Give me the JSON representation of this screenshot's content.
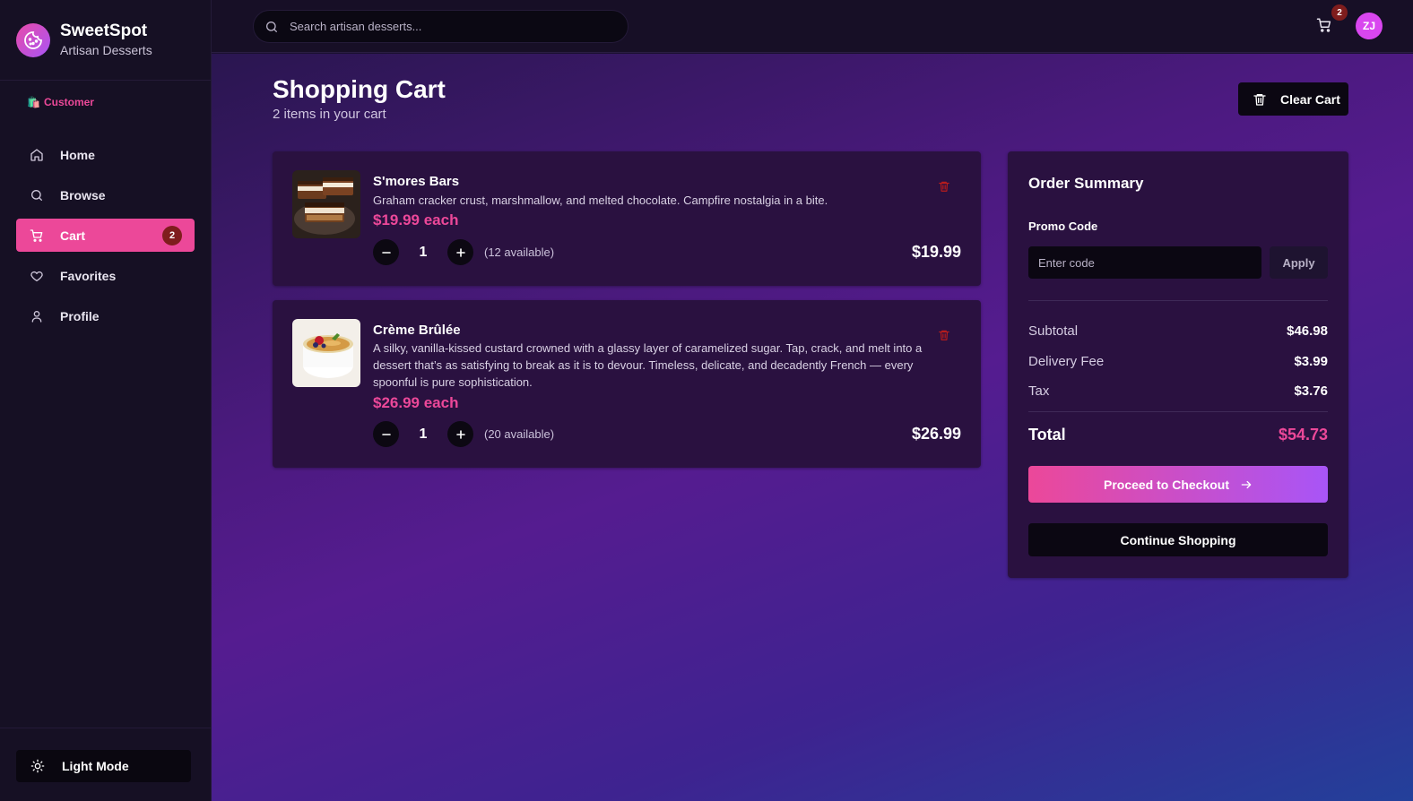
{
  "brand": {
    "name": "SweetSpot",
    "tagline": "Artisan Desserts"
  },
  "role": {
    "emoji": "🛍️",
    "label": "Customer"
  },
  "nav": {
    "items": [
      {
        "label": "Home",
        "icon": "home-icon"
      },
      {
        "label": "Browse",
        "icon": "search-icon"
      },
      {
        "label": "Cart",
        "icon": "cart-icon",
        "badge": "2",
        "active": true
      },
      {
        "label": "Favorites",
        "icon": "heart-icon"
      },
      {
        "label": "Profile",
        "icon": "user-icon"
      }
    ]
  },
  "theme_toggle": {
    "label": "Light Mode"
  },
  "topbar": {
    "search_placeholder": "Search artisan desserts...",
    "cart_badge": "2",
    "avatar_initials": "ZJ"
  },
  "page": {
    "title": "Shopping Cart",
    "subtitle": "2 items in your cart",
    "clear_label": "Clear Cart"
  },
  "cart_items": [
    {
      "name": "S'mores Bars",
      "description": "Graham cracker crust, marshmallow, and melted chocolate. Campfire nostalgia in a bite.",
      "price_each": "$19.99 each",
      "quantity": "1",
      "available": "(12 available)",
      "line_total": "$19.99"
    },
    {
      "name": "Crème Brûlée",
      "description": "A silky, vanilla-kissed custard crowned with a glassy layer of caramelized sugar. Tap, crack, and melt into a dessert that’s as satisfying to break as it is to devour. Timeless, delicate, and decadently French — every spoonful is pure sophistication.",
      "price_each": "$26.99 each",
      "quantity": "1",
      "available": "(20 available)",
      "line_total": "$26.99"
    }
  ],
  "summary": {
    "title": "Order Summary",
    "promo_label": "Promo Code",
    "promo_placeholder": "Enter code",
    "apply_label": "Apply",
    "subtotal_label": "Subtotal",
    "subtotal": "$46.98",
    "delivery_label": "Delivery Fee",
    "delivery": "$3.99",
    "tax_label": "Tax",
    "tax": "$3.76",
    "total_label": "Total",
    "total": "$54.73",
    "checkout_label": "Proceed to Checkout",
    "continue_label": "Continue Shopping"
  },
  "colors": {
    "accent": "#ec4899",
    "accent_gradient_end": "#a855f7",
    "badge": "#7f1d1d",
    "delete_icon": "#b91c1c"
  }
}
